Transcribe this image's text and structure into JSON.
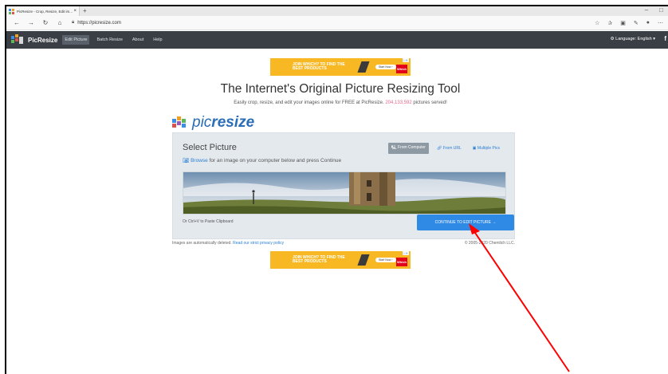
{
  "browser": {
    "tab_title": "PicResize - Crop, Resize, Edit im...",
    "tab_close": "×",
    "new_tab": "+",
    "url": "https://picresize.com",
    "nav_back": "←",
    "nav_forward": "→",
    "nav_refresh": "↻",
    "nav_home": "⌂",
    "window_minimize": "–",
    "window_maximize": "□"
  },
  "site_nav": {
    "brand": "PicResize",
    "links": [
      "Edit Picture",
      "Batch Resize",
      "About",
      "Help"
    ],
    "language": "⚙ Language: English ▾",
    "facebook": "f"
  },
  "ad": {
    "line1": "JOIN WHICH? TO FIND THE",
    "line2": "BEST PRODUCTS",
    "button": "Start Now ›",
    "badge": "Which"
  },
  "headline": "The Internet's Original Picture Resizing Tool",
  "subline": {
    "before": "Easily crop, resize, and edit your images online for FREE at PicResize.",
    "count": "204,133,592",
    "after": "pictures served!"
  },
  "logo": {
    "text_light": "pic",
    "text_bold": "resize"
  },
  "card": {
    "title": "Select Picture",
    "hint_link": "Browse",
    "hint_rest": "for an image on your computer below and press Continue",
    "source_tabs": [
      "From Computer",
      "From URL",
      "Multiple Pics"
    ],
    "paste_hint": "Or Ctrl+V to Paste Clipboard",
    "continue_button": "CONTINUE TO EDIT PICTURE →"
  },
  "footer": {
    "deleted": "Images are automatically deleted.",
    "policy": "Read our strict privacy policy",
    "copyright": "© 2005-2020 Chemlich LLC."
  },
  "colors": {
    "nav_bg": "#3a3f45",
    "accent": "#2f8ae6",
    "ad_bg": "#f7b824",
    "annotation_arrow": "#ff0000"
  }
}
